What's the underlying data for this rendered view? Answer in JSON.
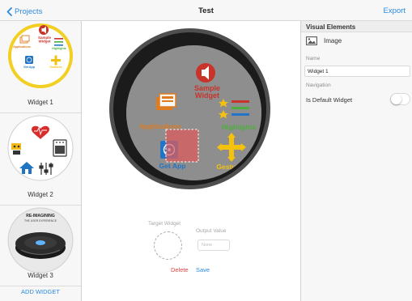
{
  "nav": {
    "back_label": "Projects",
    "title": "Test",
    "export_label": "Export"
  },
  "sidebar": {
    "widgets": [
      {
        "label": "Widget 1",
        "selected": true
      },
      {
        "label": "Widget 2",
        "selected": false
      },
      {
        "label": "Widget 3",
        "selected": false
      }
    ],
    "add_label": "ADD WIDGET"
  },
  "thumbs": {
    "w1": {
      "sample": "Sample\nWidget",
      "applications": "Applications",
      "highlights": "Highlights",
      "get_app": "Get App",
      "gestures": "Gestures"
    },
    "w3": {
      "line1": "RE-IMAGINING",
      "line2": "THE USER EXPERIENCE"
    }
  },
  "watch_face": {
    "sample_line1": "Sample",
    "sample_line2": "Widget",
    "applications": "Applications",
    "highlights": "Highlights",
    "get_app": "Get App",
    "gestures": "Gestures"
  },
  "editor": {
    "target_label": "Target Widget",
    "output_label": "Output Value",
    "output_placeholder": "None",
    "delete_label": "Delete",
    "save_label": "Save"
  },
  "inspector": {
    "header": "Visual Elements",
    "element_type": "Image",
    "name_caption": "Name",
    "name_value": "Widget 1",
    "navigation_caption": "Navigation",
    "default_label": "Is Default Widget",
    "is_default": false
  },
  "colors": {
    "accent": "#2a8be0",
    "delete": "#e04646",
    "selected_ring": "#f2cf22",
    "sample_red": "#c8332a",
    "orange": "#e07b1f",
    "green": "#4caf3c",
    "yellow": "#f4c20d",
    "blue": "#2374c6"
  }
}
